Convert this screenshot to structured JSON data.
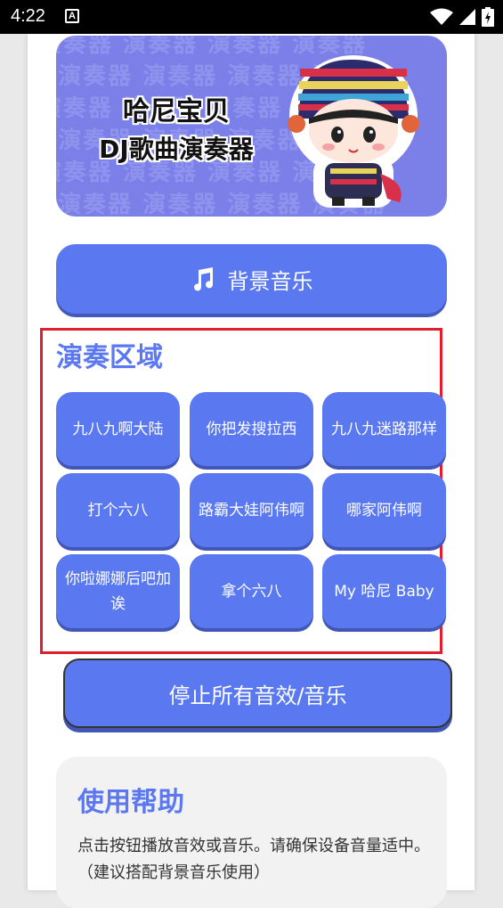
{
  "status_bar": {
    "time": "4:22",
    "notification_icon": "a-box-icon",
    "icons": [
      "wifi-icon",
      "signal-icon",
      "battery-icon"
    ]
  },
  "banner": {
    "title": "哈尼宝贝",
    "subtitle": "DJ歌曲演奏器",
    "pattern_text": "演奏器"
  },
  "bg_music": {
    "label": "背景音乐",
    "icon": "music-note-icon"
  },
  "play_area": {
    "title": "演奏区域",
    "pads": [
      "九八九啊大陆",
      "你把发搜拉西",
      "九八九迷路那样",
      "打个六八",
      "路霸大娃阿伟啊",
      "哪家阿伟啊",
      "你啦娜娜后吧加诶",
      "拿个六八",
      "My 哈尼 Baby"
    ]
  },
  "stop_button": {
    "label": "停止所有音效/音乐"
  },
  "help": {
    "title": "使用帮助",
    "text": "点击按钮播放音效或音乐。请确保设备音量适中。（建议搭配背景音乐使用）"
  },
  "colors": {
    "accent": "#5a78f0",
    "title_blue": "#5b78f0",
    "highlight_border": "#e01e2d",
    "banner_bg": "#7b80e8"
  }
}
